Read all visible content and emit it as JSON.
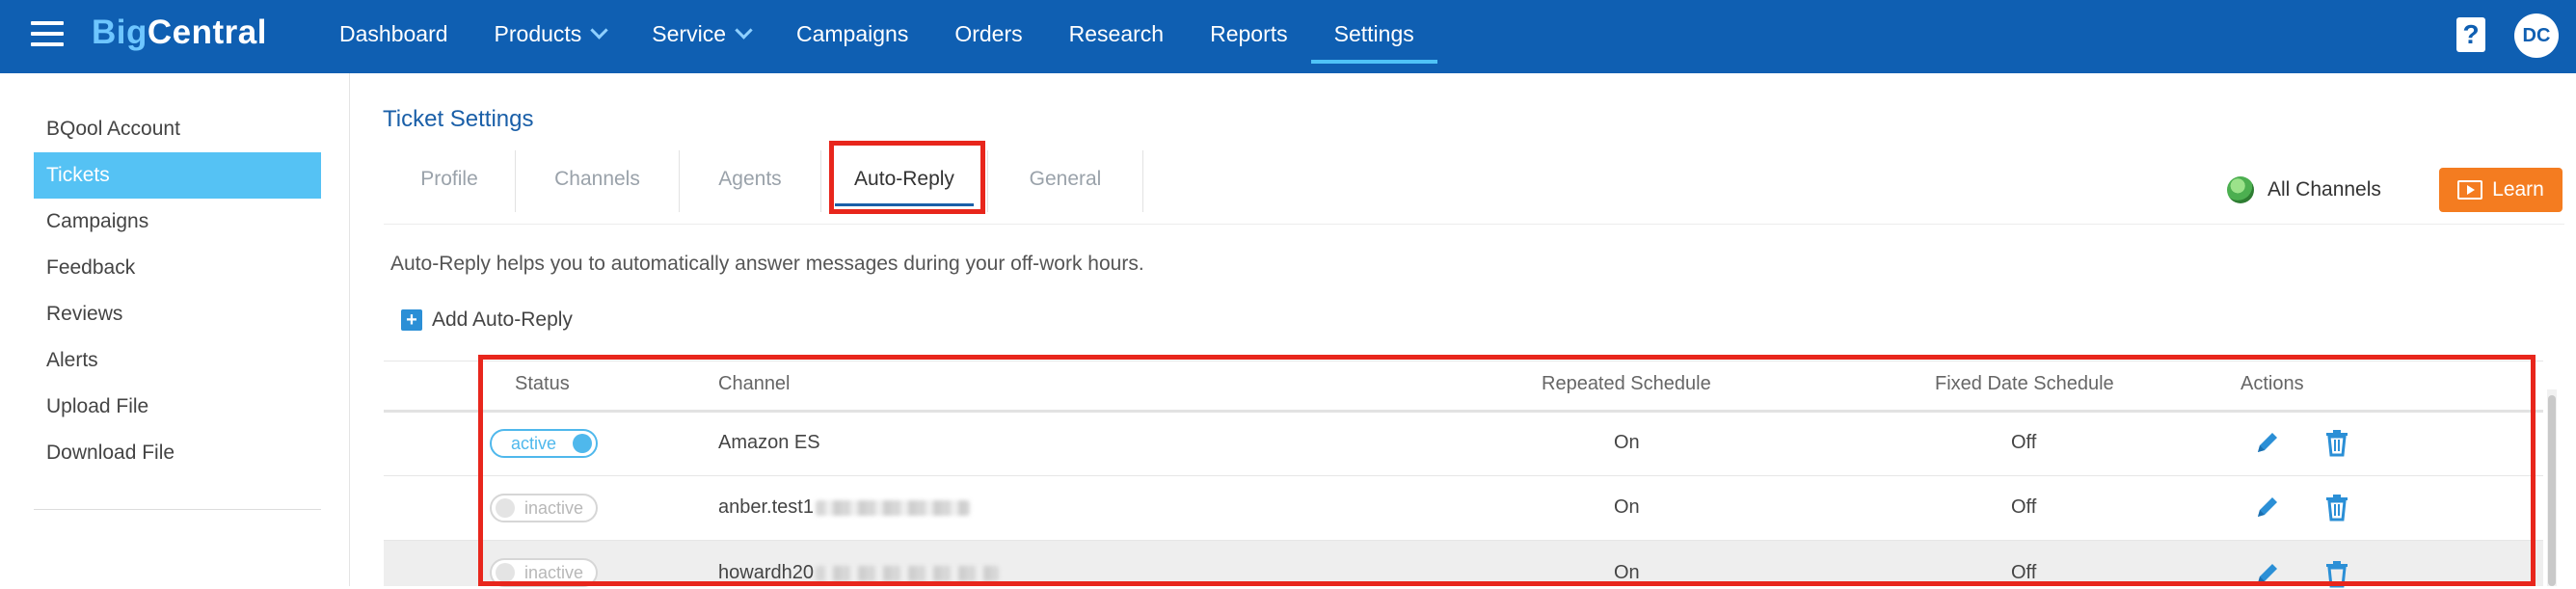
{
  "header": {
    "logo_big": "Big",
    "logo_central": "Central",
    "nav": [
      {
        "label": "Dashboard"
      },
      {
        "label": "Products",
        "dropdown": true
      },
      {
        "label": "Service",
        "dropdown": true
      },
      {
        "label": "Campaigns"
      },
      {
        "label": "Orders"
      },
      {
        "label": "Research"
      },
      {
        "label": "Reports"
      },
      {
        "label": "Settings",
        "active": true
      }
    ],
    "help_glyph": "?",
    "user_initials": "DC"
  },
  "sidebar": {
    "items": [
      {
        "label": "BQool Account"
      },
      {
        "label": "Tickets",
        "active": true
      },
      {
        "label": "Campaigns"
      },
      {
        "label": "Feedback"
      },
      {
        "label": "Reviews"
      },
      {
        "label": "Alerts"
      },
      {
        "label": "Upload File"
      },
      {
        "label": "Download File"
      }
    ]
  },
  "main": {
    "title": "Ticket Settings",
    "tabs": [
      {
        "label": "Profile"
      },
      {
        "label": "Channels"
      },
      {
        "label": "Agents"
      },
      {
        "label": "Auto-Reply",
        "active": true
      },
      {
        "label": "General"
      }
    ],
    "channel_filter": "All Channels",
    "learn_label": "Learn",
    "description": "Auto-Reply helps you to automatically answer messages during your off-work hours.",
    "add_label": "Add Auto-Reply",
    "table": {
      "columns": [
        "Status",
        "Channel",
        "Repeated Schedule",
        "Fixed Date Schedule",
        "Actions"
      ],
      "rows": [
        {
          "status": "active",
          "channel": "Amazon ES",
          "repeated": "On",
          "fixed": "Off"
        },
        {
          "status": "inactive",
          "channel": "anber.test1",
          "repeated": "On",
          "fixed": "Off"
        },
        {
          "status": "inactive",
          "channel": "howardh20",
          "repeated": "On",
          "fixed": "Off"
        }
      ]
    }
  },
  "colors": {
    "nav_bg": "#0f5fb2",
    "sidebar_active": "#55c2f4",
    "learn_btn": "#f47c20",
    "highlight_box": "#e8261c",
    "toggle_active": "#4fb8ec"
  }
}
